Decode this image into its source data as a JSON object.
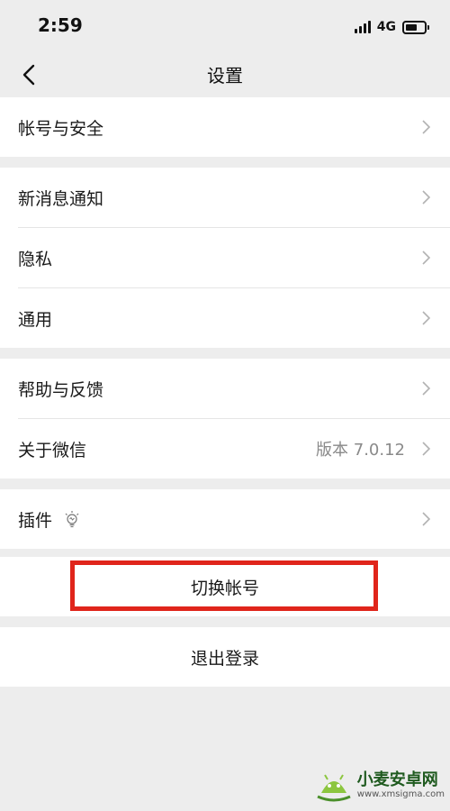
{
  "status_bar": {
    "time": "2:59",
    "network": "4G",
    "signal_icon": "signal-bars-icon",
    "battery_icon": "battery-icon"
  },
  "nav": {
    "title": "设置",
    "back_icon": "chevron-left-icon"
  },
  "groups": [
    {
      "items": [
        {
          "label": "帐号与安全"
        }
      ]
    },
    {
      "items": [
        {
          "label": "新消息通知"
        },
        {
          "label": "隐私"
        },
        {
          "label": "通用"
        }
      ]
    },
    {
      "items": [
        {
          "label": "帮助与反馈"
        },
        {
          "label": "关于微信",
          "value": "版本 7.0.12"
        }
      ]
    },
    {
      "items": [
        {
          "label": "插件",
          "icon": "lightbulb-icon"
        }
      ]
    }
  ],
  "actions": {
    "switch_account": "切换帐号",
    "logout": "退出登录"
  },
  "colors": {
    "background": "#ededed",
    "card": "#ffffff",
    "highlight": "#e0251b",
    "secondary_text": "#8a8a8a"
  },
  "watermark": {
    "name": "小麦安卓网",
    "url": "www.xmsigma.com"
  }
}
